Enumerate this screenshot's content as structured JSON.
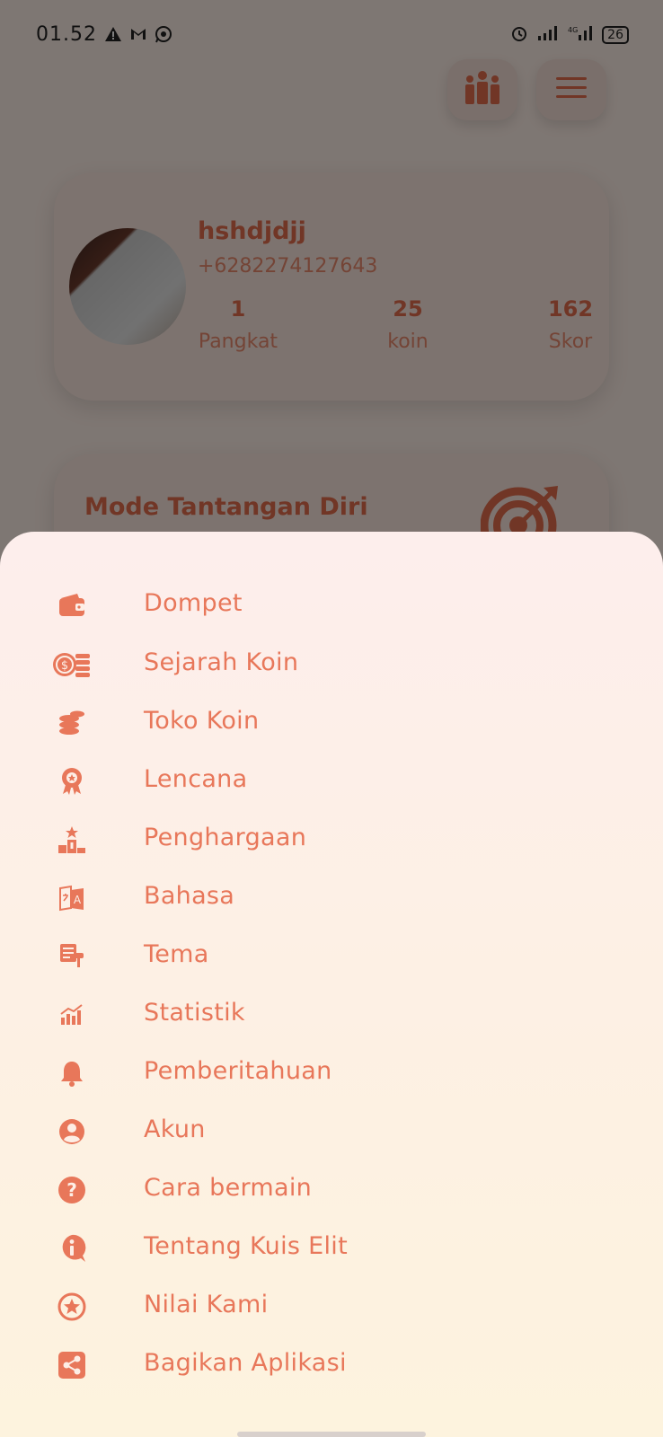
{
  "status_bar": {
    "time": "01.52",
    "battery": "26",
    "network": "4G"
  },
  "profile": {
    "name": "hshdjdjj",
    "phone": "+6282274127643",
    "stats": [
      {
        "value": "1",
        "label": "Pangkat"
      },
      {
        "value": "25",
        "label": "koin"
      },
      {
        "value": "162",
        "label": "Skor"
      }
    ]
  },
  "challenge": {
    "title": "Mode Tantangan Diri"
  },
  "menu": {
    "items": [
      {
        "label": "Dompet",
        "icon": "wallet-icon"
      },
      {
        "label": "Sejarah Koin",
        "icon": "coin-history-icon"
      },
      {
        "label": "Toko Koin",
        "icon": "coin-stack-icon"
      },
      {
        "label": "Lencana",
        "icon": "badge-icon"
      },
      {
        "label": "Penghargaan",
        "icon": "podium-icon"
      },
      {
        "label": "Bahasa",
        "icon": "translate-icon"
      },
      {
        "label": "Tema",
        "icon": "paint-roller-icon"
      },
      {
        "label": "Statistik",
        "icon": "statistics-icon"
      },
      {
        "label": "Pemberitahuan",
        "icon": "bell-icon"
      },
      {
        "label": "Akun",
        "icon": "account-icon"
      },
      {
        "label": "Cara bermain",
        "icon": "question-icon"
      },
      {
        "label": "Tentang Kuis Elit",
        "icon": "info-icon"
      },
      {
        "label": "Nilai Kami",
        "icon": "star-icon"
      },
      {
        "label": "Bagikan Aplikasi",
        "icon": "share-icon"
      }
    ]
  },
  "colors": {
    "accent": "#e8775a",
    "accent_dark": "#e36d4d",
    "sheet_bg": "#fdf0e4"
  }
}
